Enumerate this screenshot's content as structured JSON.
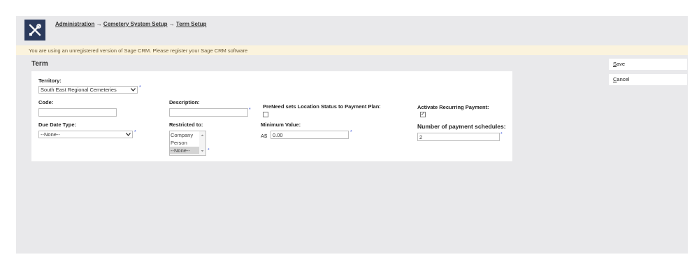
{
  "breadcrumb": {
    "items": [
      "Administration",
      "Cemetery System Setup",
      "Term Setup"
    ],
    "separator": "→"
  },
  "banner": {
    "text": "You are using an unregistered version of Sage CRM. Please register your Sage CRM software"
  },
  "page_title": "Term",
  "form": {
    "territory": {
      "label": "Territory:",
      "value": "South East Regional Cemeteries"
    },
    "code": {
      "label": "Code:",
      "value": ""
    },
    "description": {
      "label": "Description:",
      "value": ""
    },
    "preneed": {
      "label": "PreNeed sets Location Status to Payment Plan:",
      "checked": false
    },
    "activate_recurring": {
      "label": "Activate Recurring Payment:",
      "checked": true
    },
    "due_date_type": {
      "label": "Due Date Type:",
      "value": "--None--"
    },
    "restricted_to": {
      "label": "Restricted to:",
      "options": [
        "Company",
        "Person",
        "--None--"
      ],
      "selected": "--None--"
    },
    "minimum_value": {
      "label": "Minimum Value:",
      "currency": "A$",
      "value": "0.00"
    },
    "num_schedules": {
      "label": "Number of payment schedules:",
      "value": "2"
    },
    "required_marker": "*"
  },
  "actions": {
    "save": {
      "accesskey": "S",
      "rest": "ave"
    },
    "cancel": {
      "accesskey": "C",
      "rest": "ancel"
    }
  },
  "icons": {
    "logo": "tools-icon",
    "dropdown": "chevron-down-icon"
  },
  "colors": {
    "logo_bg": "#2b3a5c",
    "banner_bg": "#fbf3dd",
    "required": "#3b55d9",
    "page_bg": "#e9e9eb"
  }
}
